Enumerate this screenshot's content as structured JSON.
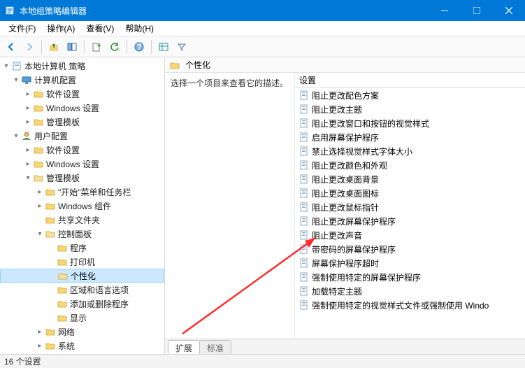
{
  "titlebar": {
    "title": "本地组策略编辑器"
  },
  "menubar": {
    "file": "文件(F)",
    "action": "操作(A)",
    "view": "查看(V)",
    "help": "帮助(H)"
  },
  "tree": {
    "root": "本地计算机 策略",
    "computer": "计算机配置",
    "c_software": "软件设置",
    "c_windows": "Windows 设置",
    "c_admin": "管理模板",
    "user": "用户配置",
    "u_software": "软件设置",
    "u_windows": "Windows 设置",
    "u_admin": "管理模板",
    "start_taskbar": "\"开始\"菜单和任务栏",
    "win_components": "Windows 组件",
    "shared_folders": "共享文件夹",
    "control_panel": "控制面板",
    "programs": "程序",
    "printers": "打印机",
    "personalization": "个性化",
    "region_lang": "区域和语言选项",
    "add_remove": "添加或删除程序",
    "display": "显示",
    "network": "网络",
    "system": "系统"
  },
  "rightpane": {
    "path_label": "个性化",
    "desc_prompt": "选择一个项目来查看它的描述。",
    "column_header": "设置",
    "tabs": {
      "extended": "扩展",
      "standard": "标准"
    },
    "items": [
      "阻止更改配色方案",
      "阻止更改主题",
      "阻止更改窗口和按钮的视觉样式",
      "启用屏幕保护程序",
      "禁止选择视觉样式字体大小",
      "阻止更改颜色和外观",
      "阻止更改桌面背景",
      "阻止更改桌面图标",
      "阻止更改鼠标指针",
      "阻止更改屏幕保护程序",
      "阻止更改声音",
      "带密码的屏幕保护程序",
      "屏幕保护程序超时",
      "强制使用特定的屏幕保护程序",
      "加载特定主题",
      "强制使用特定的视觉样式文件或强制使用 Windo"
    ]
  },
  "status": {
    "text": "16 个设置"
  },
  "colors": {
    "accent": "#0078d7"
  }
}
